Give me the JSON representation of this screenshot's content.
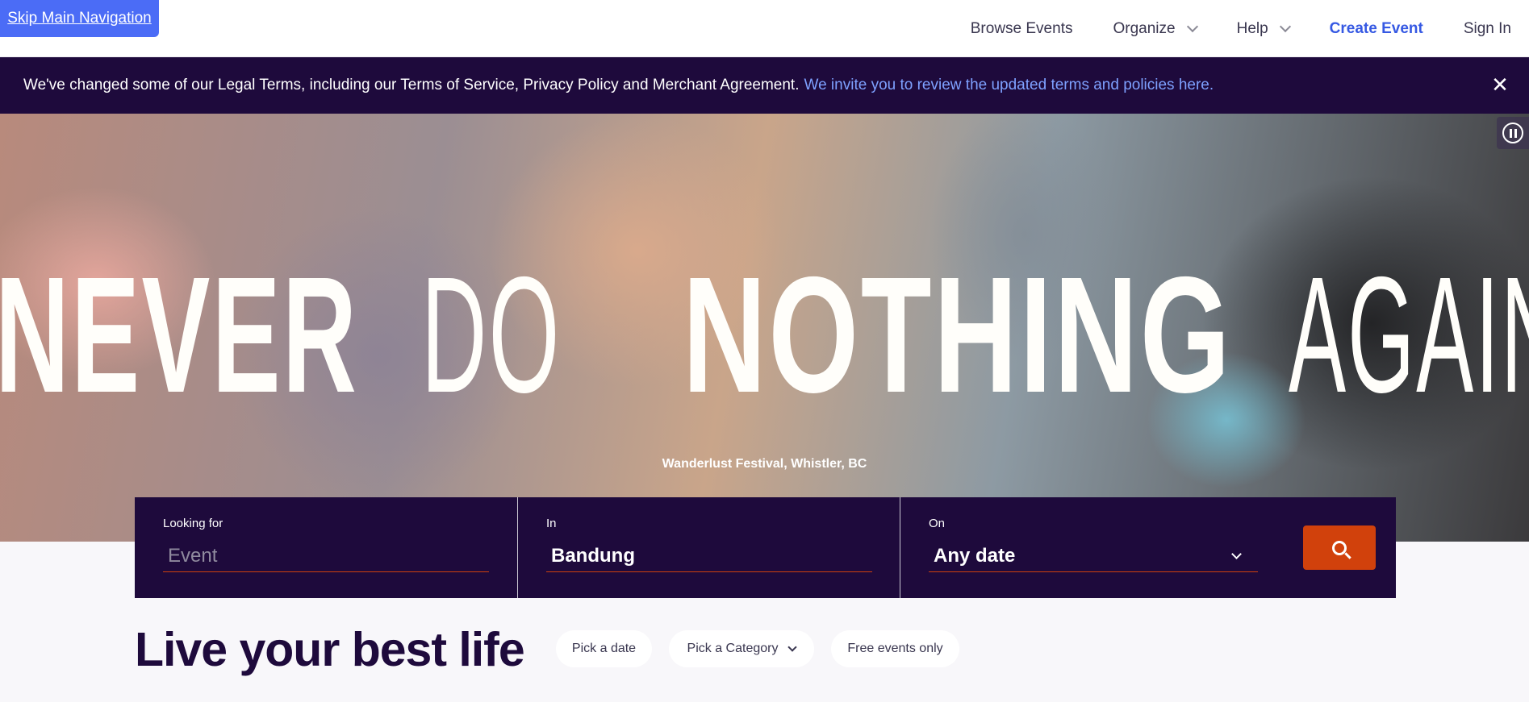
{
  "skip_link": "Skip Main Navigation",
  "nav": {
    "browse_events": "Browse Events",
    "organize": "Organize",
    "help": "Help",
    "create_event": "Create Event",
    "sign_in": "Sign In"
  },
  "legal_banner": {
    "text": "We've changed some of our Legal Terms, including our Terms of Service, Privacy Policy and Merchant Agreement.",
    "link": "We invite you to review the updated terms and policies here.",
    "close": "✕"
  },
  "hero": {
    "word_never": "NEVER",
    "word_do": "DO",
    "word_nothing": "NOTHING",
    "word_again": "AGAIN",
    "caption": "Wanderlust Festival, Whistler, BC"
  },
  "search": {
    "looking_for_label": "Looking for",
    "looking_for_placeholder": "Event",
    "in_label": "In",
    "in_value": "Bandung",
    "on_label": "On",
    "on_value": "Any date"
  },
  "tagline": "Live your best life",
  "filters": {
    "pick_date": "Pick a date",
    "pick_category": "Pick a Category",
    "free_only": "Free events only"
  },
  "colors": {
    "brand_dark": "#1e0a3c",
    "accent_orange": "#d1410c",
    "link_blue": "#3659e3"
  }
}
